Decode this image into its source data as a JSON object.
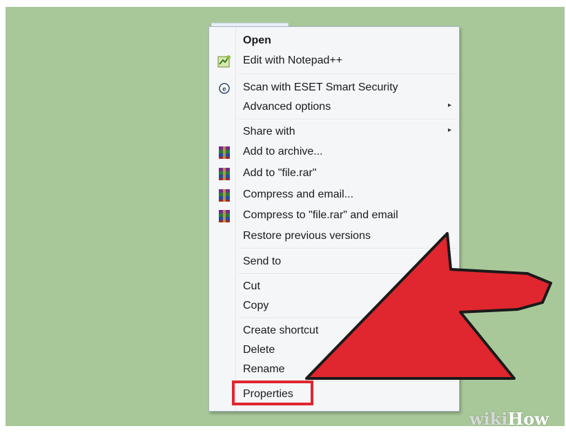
{
  "context_menu": {
    "items": [
      {
        "label": "Open",
        "bold": true,
        "icon": "",
        "submenu": false
      },
      {
        "label": "Edit with Notepad++",
        "bold": false,
        "icon": "notepad-plus-plus-icon",
        "submenu": false
      },
      {
        "label": "Scan with ESET Smart Security",
        "bold": false,
        "icon": "eset-icon",
        "submenu": false
      },
      {
        "label": "Advanced options",
        "bold": false,
        "icon": "",
        "submenu": true
      },
      {
        "label": "Share with",
        "bold": false,
        "icon": "",
        "submenu": true
      },
      {
        "label": "Add to archive...",
        "bold": false,
        "icon": "winrar-icon",
        "submenu": false
      },
      {
        "label": "Add to \"file.rar\"",
        "bold": false,
        "icon": "winrar-icon",
        "submenu": false
      },
      {
        "label": "Compress and email...",
        "bold": false,
        "icon": "winrar-icon",
        "submenu": false
      },
      {
        "label": "Compress to \"file.rar\" and email",
        "bold": false,
        "icon": "winrar-icon",
        "submenu": false
      },
      {
        "label": "Restore previous versions",
        "bold": false,
        "icon": "",
        "submenu": false
      },
      {
        "label": "Send to",
        "bold": false,
        "icon": "",
        "submenu": true
      },
      {
        "label": "Cut",
        "bold": false,
        "icon": "",
        "submenu": false
      },
      {
        "label": "Copy",
        "bold": false,
        "icon": "",
        "submenu": false
      },
      {
        "label": "Create shortcut",
        "bold": false,
        "icon": "",
        "submenu": false
      },
      {
        "label": "Delete",
        "bold": false,
        "icon": "",
        "submenu": false
      },
      {
        "label": "Rename",
        "bold": false,
        "icon": "",
        "submenu": false
      },
      {
        "label": "Properties",
        "bold": false,
        "icon": "",
        "submenu": false
      }
    ],
    "submenu_arrow": "▸"
  },
  "annotation": {
    "arrow_color": "#e0262e",
    "highlight_color": "#e0262e",
    "target": "Properties"
  },
  "watermark": {
    "wiki": "wiki",
    "how": "How"
  },
  "colors": {
    "background": "#a8c89a",
    "menu": "#f4f6f8"
  }
}
